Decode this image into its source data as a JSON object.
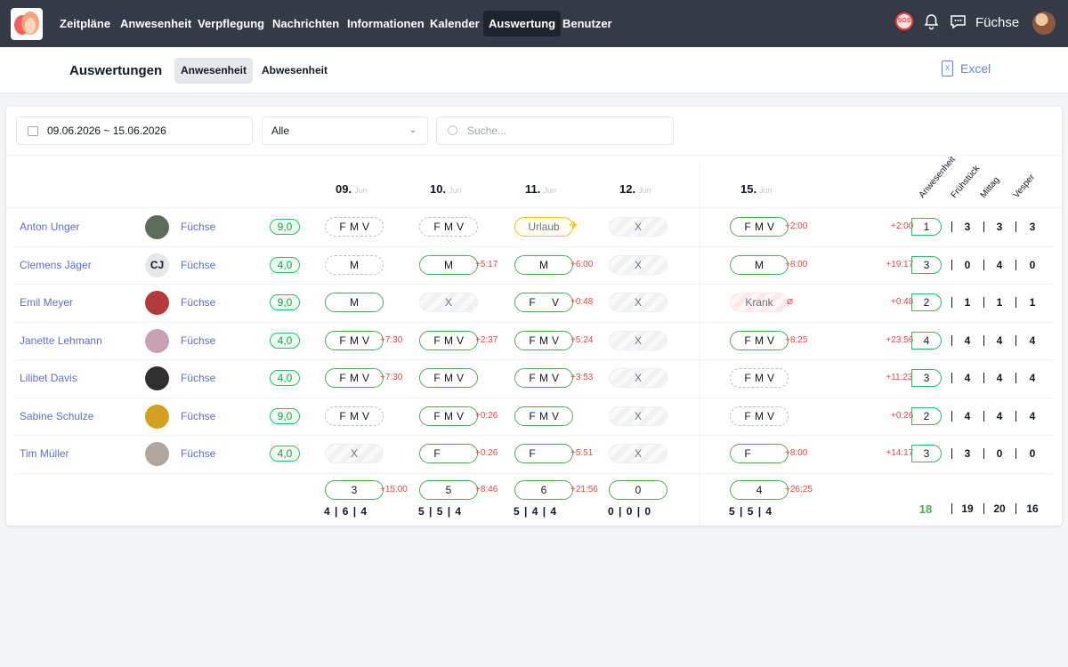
{
  "nav": {
    "items": [
      "Zeitpläne",
      "Anwesenheit",
      "Verpflegung",
      "Nachrichten",
      "Informationen",
      "Kalender",
      "Auswertung",
      "Benutzer"
    ],
    "active": "Auswertung",
    "sos": "SOS",
    "group": "Füchse"
  },
  "sub": {
    "title": "Auswertungen",
    "tabs": [
      "Anwesenheit",
      "Abwesenheit"
    ],
    "excel": "Excel"
  },
  "filters": {
    "daterange": "09.06.2026 ~ 15.06.2026",
    "select": "Alle",
    "search_placeholder": "Suche..."
  },
  "days": [
    {
      "d": "09.",
      "m": "Jun"
    },
    {
      "d": "10.",
      "m": "Jun"
    },
    {
      "d": "11.",
      "m": "Jun"
    },
    {
      "d": "12.",
      "m": "Jun"
    },
    {
      "d": "15.",
      "m": "Jun"
    }
  ],
  "colheaders": [
    "Anwesenheit",
    "Frühstück",
    "Mittag",
    "Vesper"
  ],
  "rows": [
    {
      "name": "Anton Unger",
      "avatar": "photo",
      "group": "Füchse",
      "badge": "9,0",
      "cells": [
        {
          "t": "d",
          "v": [
            "F",
            "M",
            "V"
          ]
        },
        {
          "t": "d",
          "v": [
            "F",
            "M",
            "V"
          ]
        },
        {
          "t": "u",
          "label": "Urlaub"
        },
        {
          "t": "x"
        },
        {
          "t": "g",
          "v": [
            "F",
            "M",
            "V"
          ],
          "ot": "+2:00"
        }
      ],
      "total_ot": "+2:00",
      "att": "1",
      "fr": "3",
      "mi": "3",
      "ve": "3"
    },
    {
      "name": "Clemens Jäger",
      "avatar": "CJ",
      "group": "Füchse",
      "badge": "4,0",
      "cells": [
        {
          "t": "d",
          "v": [
            "M"
          ]
        },
        {
          "t": "g",
          "v": [
            "M"
          ],
          "ot": "+5:17"
        },
        {
          "t": "g",
          "v": [
            "M"
          ],
          "ot": "+6:00"
        },
        {
          "t": "x"
        },
        {
          "t": "g",
          "v": [
            "M"
          ],
          "ot": "+8:00"
        }
      ],
      "total_ot": "+19:17",
      "att": "3",
      "fr": "0",
      "mi": "4",
      "ve": "0"
    },
    {
      "name": "Emil Meyer",
      "avatar": "photo",
      "group": "Füchse",
      "badge": "9,0",
      "cells": [
        {
          "t": "g",
          "v": [
            "M"
          ]
        },
        {
          "t": "x"
        },
        {
          "t": "g",
          "v": [
            "F",
            "",
            "V"
          ],
          "ot": "+0:48"
        },
        {
          "t": "x"
        },
        {
          "t": "k",
          "label": "Krank"
        }
      ],
      "total_ot": "+0:48",
      "att": "2",
      "fr": "1",
      "mi": "1",
      "ve": "1"
    },
    {
      "name": "Janette Lehmann",
      "avatar": "photo",
      "group": "Füchse",
      "badge": "4,0",
      "cells": [
        {
          "t": "g",
          "v": [
            "F",
            "M",
            "V"
          ],
          "ot": "+7:30"
        },
        {
          "t": "g",
          "v": [
            "F",
            "M",
            "V"
          ],
          "ot": "+2:37"
        },
        {
          "t": "g",
          "v": [
            "F",
            "M",
            "V"
          ],
          "ot": "+5:24"
        },
        {
          "t": "x"
        },
        {
          "t": "g",
          "v": [
            "F",
            "M",
            "V"
          ],
          "ot": "+8:25"
        }
      ],
      "total_ot": "+23:56",
      "att": "4",
      "fr": "4",
      "mi": "4",
      "ve": "4"
    },
    {
      "name": "Lilibet Davis",
      "avatar": "photo",
      "group": "Füchse",
      "badge": "4,0",
      "cells": [
        {
          "t": "g",
          "v": [
            "F",
            "M",
            "V"
          ],
          "ot": "+7:30"
        },
        {
          "t": "g",
          "v": [
            "F",
            "M",
            "V"
          ]
        },
        {
          "t": "g",
          "v": [
            "F",
            "M",
            "V"
          ],
          "ot": "+3:53"
        },
        {
          "t": "x"
        },
        {
          "t": "d",
          "v": [
            "F",
            "M",
            "V"
          ]
        }
      ],
      "total_ot": "+11:23",
      "att": "3",
      "fr": "4",
      "mi": "4",
      "ve": "4"
    },
    {
      "name": "Sabine Schulze",
      "avatar": "photo",
      "group": "Füchse",
      "badge": "9,0",
      "cells": [
        {
          "t": "d",
          "v": [
            "F",
            "M",
            "V"
          ]
        },
        {
          "t": "g",
          "v": [
            "F",
            "M",
            "V"
          ],
          "ot": "+0:26"
        },
        {
          "t": "g",
          "v": [
            "F",
            "M",
            "V"
          ]
        },
        {
          "t": "x"
        },
        {
          "t": "d",
          "v": [
            "F",
            "M",
            "V"
          ]
        }
      ],
      "total_ot": "+0:26",
      "att": "2",
      "fr": "4",
      "mi": "4",
      "ve": "4"
    },
    {
      "name": "Tim Müller",
      "avatar": "photo",
      "group": "Füchse",
      "badge": "4,0",
      "cells": [
        {
          "t": "x"
        },
        {
          "t": "g",
          "v": [
            "F",
            "",
            ""
          ],
          "ot": "+0:26"
        },
        {
          "t": "g",
          "v": [
            "F",
            "",
            ""
          ],
          "ot": "+5:51"
        },
        {
          "t": "x"
        },
        {
          "t": "g",
          "v": [
            "F",
            "",
            ""
          ],
          "ot": "+8:00"
        }
      ],
      "total_ot": "+14:17",
      "att": "3",
      "fr": "3",
      "mi": "0",
      "ve": "0"
    }
  ],
  "totals": {
    "days": [
      {
        "count": "3",
        "ot": "+15:00",
        "meals": [
          "4",
          "6",
          "4"
        ]
      },
      {
        "count": "5",
        "ot": "+8:46",
        "meals": [
          "5",
          "5",
          "4"
        ]
      },
      {
        "count": "6",
        "ot": "+21:56",
        "meals": [
          "5",
          "4",
          "4"
        ]
      },
      {
        "count": "0",
        "ot": "",
        "meals": [
          "0",
          "0",
          "0"
        ]
      },
      {
        "count": "4",
        "ot": "+26:25",
        "meals": [
          "5",
          "5",
          "4"
        ]
      }
    ],
    "att": "18",
    "fr": "19",
    "mi": "20",
    "ve": "16"
  },
  "colors": {
    "nav": "#343a46",
    "link": "#5b6fcc",
    "green": "#22c55e",
    "overtime": "#ef4444",
    "urlaub": "#f1c40f"
  }
}
